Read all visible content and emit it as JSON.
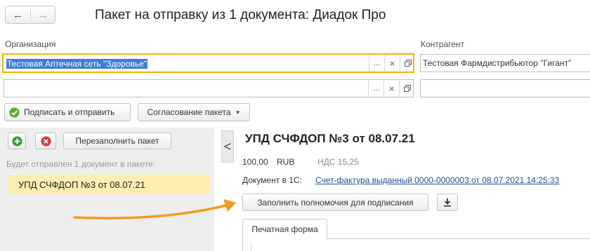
{
  "window": {
    "title": "Пакет на отправку из 1 документа: Диадок Про",
    "nav_back": "←",
    "nav_forward": "→"
  },
  "organization": {
    "label": "Организация",
    "value": "Тестовая Аптечная сеть \"Здоровье\"",
    "select_glyph": "...",
    "clear_glyph": "×"
  },
  "counterparty": {
    "label": "Контрагент",
    "value": "Тестовая Фармдистрибьютор \"Гигант\""
  },
  "second_row": {
    "value": "",
    "select_glyph": "...",
    "clear_glyph": "×"
  },
  "toolbar": {
    "sign_send_label": "Подписать и отправить",
    "approval_label": "Согласование пакета"
  },
  "left_panel": {
    "refill_label": "Перезаполнить пакет",
    "info_text": "Будет отправлен 1 документ в пакете:",
    "items": [
      {
        "label": "УПД СЧФДОП №3 от 08.07.21"
      }
    ]
  },
  "right_panel": {
    "title": "УПД СЧФДОП №3 от 08.07.21",
    "amount": "100,00",
    "currency": "RUB",
    "vat": "НДС 15,25",
    "doc_label": "Документ в 1С:",
    "doc_link": "Счет-фактура выданный 0000-0000003 от 08.07.2021 14:25:33",
    "fill_powers_label": "Заполнить полномочия для подписания",
    "tab_print": "Печатная форма",
    "collapse_glyph": "<"
  },
  "colors": {
    "focus_border": "#f4b400",
    "selection_bg": "#3d7bd9",
    "list_item_bg": "#fbeeb0",
    "arrow": "#f39a1c",
    "link": "#1c4e9c",
    "green_icon": "#3a9b3a",
    "red_icon": "#d93a3a"
  }
}
